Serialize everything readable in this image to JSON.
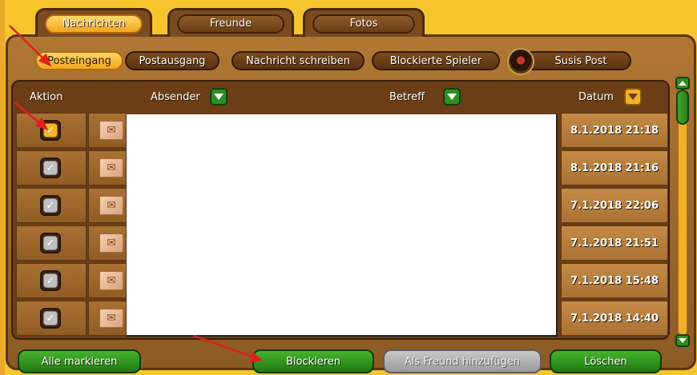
{
  "tabs": [
    {
      "label": "Nachrichten",
      "active": true
    },
    {
      "label": "Freunde",
      "active": false
    },
    {
      "label": "Fotos",
      "active": false
    }
  ],
  "subnav": [
    {
      "label": "Posteingang",
      "active": true
    },
    {
      "label": "Postausgang",
      "active": false
    },
    {
      "label": "Nachricht schreiben",
      "active": false
    },
    {
      "label": "Blockierte Spieler",
      "active": false
    }
  ],
  "profile": {
    "label": "Susis Post"
  },
  "table": {
    "headers": {
      "aktion": "Aktion",
      "absender": "Absender",
      "betreff": "Betreff",
      "datum": "Datum"
    },
    "rows": [
      {
        "checked": true,
        "date": "8.1.2018 21:18"
      },
      {
        "checked": false,
        "date": "8.1.2018 21:16"
      },
      {
        "checked": false,
        "date": "7.1.2018 22:06"
      },
      {
        "checked": false,
        "date": "7.1.2018 21:51"
      },
      {
        "checked": false,
        "date": "7.1.2018 15:48"
      },
      {
        "checked": false,
        "date": "7.1.2018 14:40"
      }
    ]
  },
  "buttons": {
    "select_all": "Alle markieren",
    "block": "Blockieren",
    "add_friend": "Als Freund hinzufügen",
    "delete": "Löschen"
  },
  "glyphs": {
    "check": "✓",
    "envelope": "✉"
  },
  "colors": {
    "accent_gold": "#f6c52e",
    "wood": "#8c5a24",
    "button_green": "#2f8f1f",
    "annotation_red": "#e0201a"
  }
}
